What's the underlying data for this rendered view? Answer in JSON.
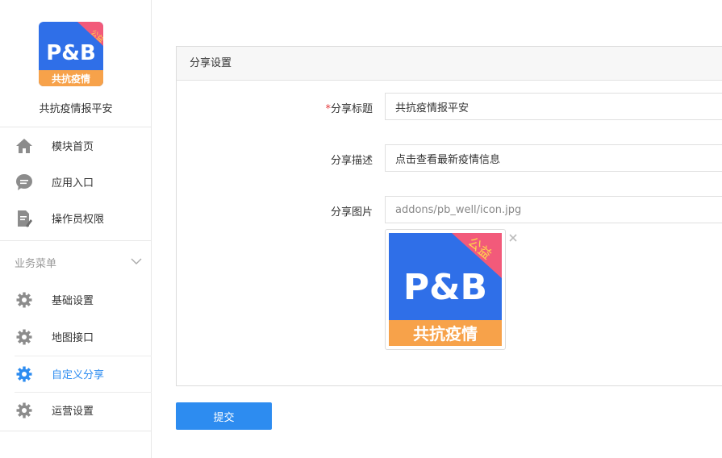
{
  "app": {
    "name": "共抗疫情报平安",
    "logo": {
      "brand_text": "P&B",
      "corner_tag": "公益",
      "ribbon_text": "共抗疫情"
    }
  },
  "sidebar": {
    "items": [
      {
        "label": "模块首页",
        "icon": "home-icon"
      },
      {
        "label": "应用入口",
        "icon": "chat-bubble-icon"
      },
      {
        "label": "操作员权限",
        "icon": "document-edit-icon"
      }
    ],
    "group": {
      "label": "业务菜单",
      "expanded": true,
      "items": [
        {
          "label": "基础设置",
          "icon": "gear-icon"
        },
        {
          "label": "地图接口",
          "icon": "gear-icon"
        },
        {
          "label": "自定义分享",
          "icon": "gear-icon",
          "active": true
        },
        {
          "label": "运营设置",
          "icon": "gear-icon"
        }
      ]
    }
  },
  "panel": {
    "title": "分享设置",
    "fields": {
      "title": {
        "label": "分享标题",
        "required_mark": "*",
        "value": "共抗疫情报平安"
      },
      "desc": {
        "label": "分享描述",
        "value": "点击查看最新疫情信息"
      },
      "image": {
        "label": "分享图片",
        "value": "addons/pb_well/icon.jpg"
      }
    }
  },
  "submit_label": "提交",
  "colors": {
    "accent": "#2d8cf0",
    "required": "#e4393c",
    "logo_blue": "#2f6fe8",
    "logo_orange": "#f7a24a",
    "logo_pink": "#f25a7a"
  }
}
